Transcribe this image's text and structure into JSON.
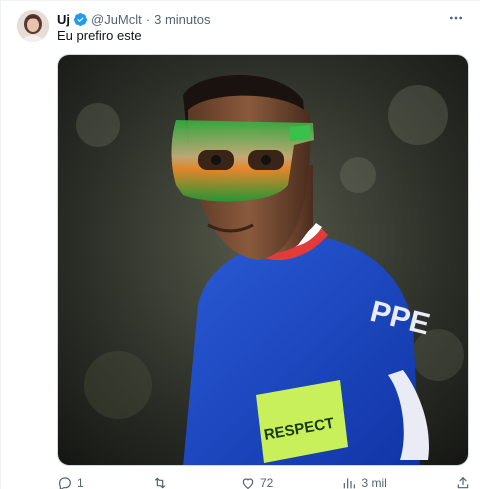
{
  "tweet": {
    "author_name": "Uj",
    "handle": "@JuMclt",
    "separator": "·",
    "time": "3 minutos",
    "text": "Eu prefiro este",
    "verified_color": "#1d9bf0",
    "image": {
      "armband_text": "RESPECT",
      "player_name_fragment": "PPE"
    },
    "actions": {
      "replies": "1",
      "retweets": "",
      "likes": "72",
      "views": "3 mil"
    }
  }
}
